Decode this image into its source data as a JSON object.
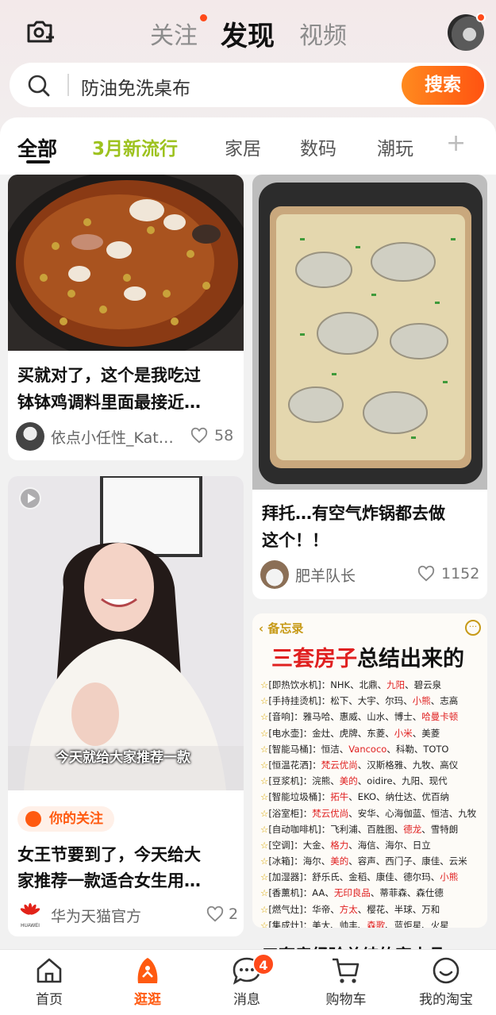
{
  "header": {
    "tabs": [
      {
        "label": "关注",
        "has_dot": true
      },
      {
        "label": "发现",
        "active": true
      },
      {
        "label": "视频"
      }
    ]
  },
  "search": {
    "query": "防油免洗桌布",
    "button_label": "搜索"
  },
  "categories": {
    "items": [
      "全部",
      "3月新流行",
      "家居",
      "数码",
      "潮玩"
    ],
    "add_symbol": "+"
  },
  "feed": {
    "left": [
      {
        "title_lines": [
          "买就对了，这个是我吃过",
          "钵钵鸡调料里面最接近…"
        ],
        "author": "依点小任性_Kat…",
        "likes": "58"
      },
      {
        "caption": "今天就给大家推荐一款",
        "badge": "你的关注",
        "title_lines": [
          "女王节要到了，今天给大",
          "家推荐一款适合女生用…"
        ],
        "author": "华为天猫官方",
        "author_logo_text": "HUAWEI",
        "likes": "2"
      }
    ],
    "right": [
      {
        "title_lines": [
          "拜托…有空气炸锅都去做",
          "这个！！"
        ],
        "author": "肥羊队长",
        "likes": "1152"
      },
      {
        "memo_back": "备忘录",
        "memo_title_red": "三套房子",
        "memo_title_rest": "总结出来的",
        "next_title": "三套房经验总结的家电品"
      }
    ]
  },
  "memo_lines": [
    [
      [
        "[即热饮水机]：NHK、北鼎、",
        ""
      ],
      [
        "九阳",
        "r"
      ],
      [
        "、碧云泉",
        ""
      ]
    ],
    [
      [
        "[手持挂烫机]：松下、大宇、尔玛、",
        ""
      ],
      [
        "小熊",
        "r"
      ],
      [
        "、志高",
        ""
      ]
    ],
    [
      [
        "[音响]：雅马哈、惠威、山水、博士、",
        ""
      ],
      [
        "哈曼卡顿",
        "r"
      ]
    ],
    [
      [
        "[电水壶]：金灶、虎牌、东菱、",
        ""
      ],
      [
        "小米",
        "r"
      ],
      [
        "、美菱",
        ""
      ]
    ],
    [
      [
        "[智能马桶]：恒洁、",
        ""
      ],
      [
        "Vancoco",
        "r"
      ],
      [
        "、科勒、TOTO",
        ""
      ]
    ],
    [
      [
        "[恒温花洒]：",
        ""
      ],
      [
        "梵云优尚",
        "r"
      ],
      [
        "、汉斯格雅、九牧、高仪",
        ""
      ]
    ],
    [
      [
        "[豆浆机]：浣熊、",
        ""
      ],
      [
        "美的",
        "r"
      ],
      [
        "、oidire、九阳、现代",
        ""
      ]
    ],
    [
      [
        "[智能垃圾桶]：",
        ""
      ],
      [
        "拓牛",
        "r"
      ],
      [
        "、EKO、纳仕达、优百纳",
        ""
      ]
    ],
    [
      [
        "[浴室柜]：",
        ""
      ],
      [
        "梵云优尚",
        "r"
      ],
      [
        "、安华、心海伽蓝、恒洁、九牧",
        ""
      ]
    ],
    [
      [
        "[自动咖啡机]：飞利浦、百胜图、",
        ""
      ],
      [
        "德龙",
        "r"
      ],
      [
        "、雪特朗",
        ""
      ]
    ],
    [
      [
        "[空调]：大金、",
        ""
      ],
      [
        "格力",
        "r"
      ],
      [
        "、海信、海尔、日立",
        ""
      ]
    ],
    [
      [
        "[冰箱]：海尔、",
        ""
      ],
      [
        "美的",
        "r"
      ],
      [
        "、容声、西门子、康佳、云米",
        ""
      ]
    ],
    [
      [
        "[加湿器]：舒乐氏、金稻、康佳、德尔玛、",
        ""
      ],
      [
        "小熊",
        "r"
      ]
    ],
    [
      [
        "[香薰机]：AA、",
        ""
      ],
      [
        "无印良品",
        "r"
      ],
      [
        "、蒂菲森、森仕德",
        ""
      ]
    ],
    [
      [
        "[燃气灶]：华帝、",
        ""
      ],
      [
        "方太",
        "r"
      ],
      [
        "、樱花、半球、万和",
        ""
      ]
    ],
    [
      [
        "[集成灶]：美大、帅丰、",
        ""
      ],
      [
        "森歌",
        "r"
      ],
      [
        "、蓝炬星、火星",
        ""
      ]
    ]
  ],
  "bottom_nav": [
    {
      "label": "首页",
      "icon": "home-icon"
    },
    {
      "label": "逛逛",
      "icon": "browse-icon",
      "active": true
    },
    {
      "label": "消息",
      "icon": "message-icon",
      "badge": "4"
    },
    {
      "label": "购物车",
      "icon": "cart-icon"
    },
    {
      "label": "我的淘宝",
      "icon": "profile-icon"
    }
  ],
  "colors": {
    "accent": "#ff5a10",
    "highlight_green": "#9dc21e",
    "memo_red": "#e02020"
  }
}
